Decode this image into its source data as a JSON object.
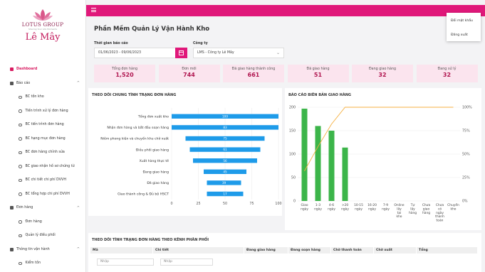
{
  "brand": {
    "company": "LOTUS GROUP",
    "slogan": "Sharing Your Life Moments",
    "name": "Lê Mây"
  },
  "sidebar": {
    "items": [
      {
        "label": "Dashboard",
        "type": "main",
        "active": true
      },
      {
        "label": "Báo cáo",
        "type": "main",
        "expand": "^"
      },
      {
        "label": "BC tồn kho",
        "type": "sub"
      },
      {
        "label": "Tiến trình xử lý đơn hàng",
        "type": "sub"
      },
      {
        "label": "BC tiến trình đơn hàng",
        "type": "sub"
      },
      {
        "label": "BC hạng mục đơn hàng",
        "type": "sub"
      },
      {
        "label": "BC đơn hàng chỉnh sửa",
        "type": "sub"
      },
      {
        "label": "BC giao nhận hồ sơ chứng từ",
        "type": "sub"
      },
      {
        "label": "BC chi tiết chi phí DVVH",
        "type": "sub"
      },
      {
        "label": "BC tổng hợp chi phí DVVH",
        "type": "sub"
      },
      {
        "label": "Đơn hàng",
        "type": "main",
        "expand": "^"
      },
      {
        "label": "Đơn hàng",
        "type": "sub"
      },
      {
        "label": "Quản lý điều phối",
        "type": "sub"
      },
      {
        "label": "Thông tin vận hành",
        "type": "main",
        "expand": "^"
      },
      {
        "label": "Kiểm tồn",
        "type": "sub"
      }
    ]
  },
  "dropdown": {
    "change_password": "Đổi mật khẩu",
    "logout": "Đăng xuất"
  },
  "page": {
    "title": "Phần Mềm Quản Lý Vận Hành Kho"
  },
  "filters": {
    "period_label": "Thời gian báo cáo",
    "period_value": "01/06/2023 - 09/06/2023",
    "company_label": "Công ty",
    "company_value": "LMS - Công ty Lê Mây",
    "company_caret": "⌄"
  },
  "stats": [
    {
      "label": "Tổng đơn hàng",
      "value": "1,520"
    },
    {
      "label": "Đơn mới",
      "value": "744"
    },
    {
      "label": "Đã giao hàng thành công",
      "value": "661"
    },
    {
      "label": "Đã giao hàng",
      "value": "51"
    },
    {
      "label": "Đang giao hàng",
      "value": "32"
    },
    {
      "label": "Đang xử lý",
      "value": "32"
    }
  ],
  "colors": {
    "accent": "#e0187a",
    "bar": "#1e9be9",
    "green": "#3cb54a",
    "line": "#f5b041"
  },
  "chart_data": [
    {
      "type": "bar",
      "orientation": "horizontal",
      "title": "THEO DÕI CHUNG TÌNH TRẠNG ĐƠN HÀNG",
      "categories": [
        "Tổng đơn xuất kho",
        "Nhận đơn hàng và bắt đầu soạn hàng",
        "Niêm phong kiện và chuyển khu chờ xuất",
        "Điều phối giao hàng",
        "Xuất hàng thực tế",
        "Đang giao hàng",
        "Đã giao hàng",
        "Giao thành công & Đủ bộ HSCT"
      ],
      "ranges": [
        [
          0,
          100
        ],
        [
          0,
          100
        ],
        [
          13,
          87
        ],
        [
          17,
          83
        ],
        [
          20,
          80
        ],
        [
          30,
          70
        ],
        [
          33,
          65
        ],
        [
          33,
          67
        ]
      ],
      "values": [
        100,
        83,
        75,
        61,
        56,
        45,
        39,
        17
      ],
      "xlim": [
        0,
        100
      ],
      "xticks": [
        "0",
        "25",
        "50",
        "75",
        "100"
      ]
    },
    {
      "type": "bar+line",
      "title": "BÁO CÁO BIÊN BẢN GIAO HÀNG",
      "categories": [
        "Giao ngày",
        "1-3 ngày",
        "4-6 ngày",
        ">20 ngày",
        "10-15 ngày",
        "16-20 ngày",
        "7-9 ngày",
        "Online lấy tại kho",
        "Tự lấy hàng",
        "Chưa giao hàng",
        "Chưa có ngày thanh toán",
        "Chuyển kho"
      ],
      "values": [
        197,
        160,
        150,
        114,
        0,
        0,
        0,
        0,
        0,
        0,
        0,
        0
      ],
      "cumulative_pct": [
        32,
        58,
        82,
        100,
        100,
        100,
        100,
        100,
        100,
        100,
        100,
        100
      ],
      "ylim": [
        0,
        200
      ],
      "yticks": [
        "0",
        "50",
        "100",
        "150",
        "200"
      ],
      "y2ticks": [
        "0%",
        "25%",
        "50%",
        "75%",
        "100%"
      ]
    }
  ],
  "table": {
    "title": "THEO DÕI TÌNH TRẠNG ĐƠN HÀNG THEO KÊNH PHÂN PHỐI",
    "columns": [
      "Mã",
      "Chi tiết",
      "Đang giao hàng",
      "Đang soạn hàng",
      "Chờ thanh toán",
      "Chờ xuất",
      "Tổng"
    ],
    "placeholder": "Nhập"
  }
}
